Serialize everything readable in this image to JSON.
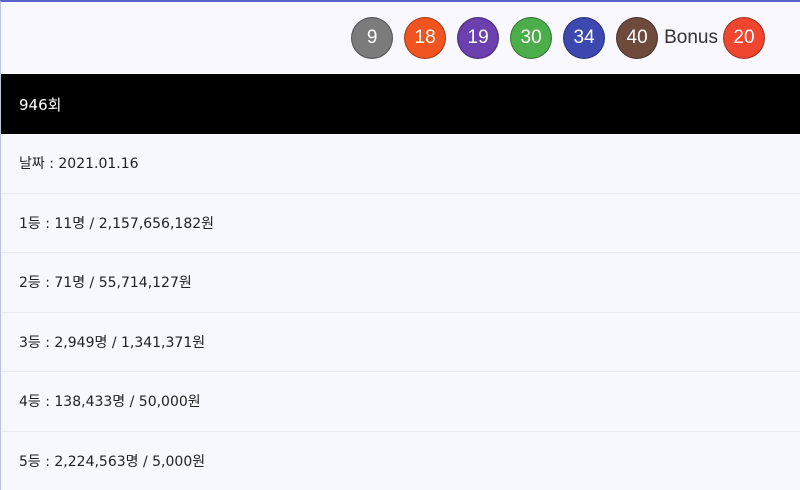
{
  "winning_numbers": [
    {
      "number": "9",
      "color": "#7b7b7b"
    },
    {
      "number": "18",
      "color": "#f2541f"
    },
    {
      "number": "19",
      "color": "#6b3fae"
    },
    {
      "number": "30",
      "color": "#4cae4a"
    },
    {
      "number": "34",
      "color": "#3c48b0"
    },
    {
      "number": "40",
      "color": "#6e4a3c"
    }
  ],
  "bonus": {
    "label": "Bonus",
    "number": "20",
    "color": "#f0452e"
  },
  "draw": {
    "round": "946회"
  },
  "rows": [
    {
      "text": "날짜 : 2021.01.16"
    },
    {
      "text": "1등 : 11명 / 2,157,656,182원"
    },
    {
      "text": "2등 : 71명 / 55,714,127원"
    },
    {
      "text": "3등 : 2,949명 / 1,341,371원"
    },
    {
      "text": "4등 : 138,433명 / 50,000원"
    },
    {
      "text": "5등 : 2,224,563명 / 5,000원"
    }
  ]
}
